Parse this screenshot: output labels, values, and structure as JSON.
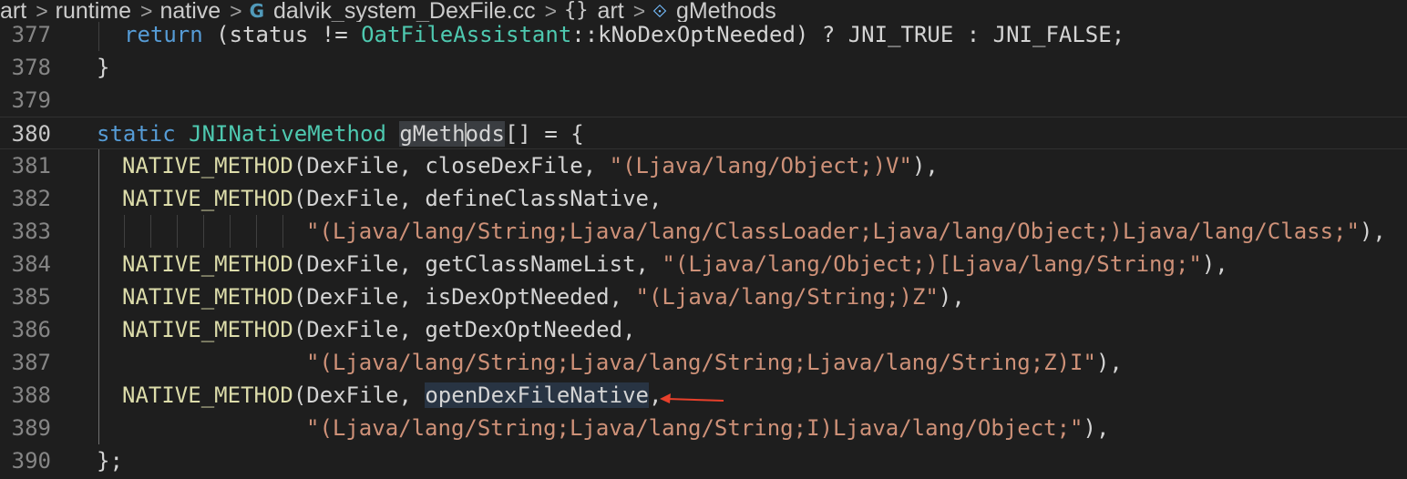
{
  "breadcrumb": {
    "items": [
      "art",
      "runtime",
      "native",
      "dalvik_system_DexFile.cc",
      "art",
      "gMethods"
    ],
    "separator": ">",
    "file_icon_glyph": "G",
    "namespace_icon_glyph": "{}",
    "variable_icon_glyph": "⟐",
    "icons": [
      "cpp-file-icon",
      "namespace-icon",
      "variable-icon"
    ]
  },
  "editor": {
    "current_line": "380",
    "line_numbers": [
      "377",
      "378",
      "379",
      "380",
      "381",
      "382",
      "383",
      "384",
      "385",
      "386",
      "387",
      "388",
      "389",
      "390"
    ],
    "code": {
      "l377": {
        "t1": "return",
        "t2": " (status != ",
        "t3": "OatFileAssistant",
        "t4": "::kNoDexOptNeeded) ? JNI_TRUE : JNI_FALSE;"
      },
      "l378": {
        "t1": "}"
      },
      "l380": {
        "t1": "static",
        "t2": " ",
        "t3": "JNINativeMethod",
        "t4": " ",
        "t5a": "gMeth",
        "t5b": "ods",
        "t6": "[] = {"
      },
      "l381": {
        "macro": "NATIVE_METHOD",
        "args": "(DexFile, closeDexFile, ",
        "str": "\"(Ljava/lang/Object;)V\"",
        "end": "),"
      },
      "l382": {
        "macro": "NATIVE_METHOD",
        "args": "(DexFile, defineClassNative,"
      },
      "l383": {
        "str": "\"(Ljava/lang/String;Ljava/lang/ClassLoader;Ljava/lang/Object;)Ljava/lang/Class;\"",
        "end": "),"
      },
      "l384": {
        "macro": "NATIVE_METHOD",
        "args": "(DexFile, getClassNameList, ",
        "str": "\"(Ljava/lang/Object;)[Ljava/lang/String;\"",
        "end": "),"
      },
      "l385": {
        "macro": "NATIVE_METHOD",
        "args": "(DexFile, isDexOptNeeded, ",
        "str": "\"(Ljava/lang/String;)Z\"",
        "end": "),"
      },
      "l386": {
        "macro": "NATIVE_METHOD",
        "args": "(DexFile, getDexOptNeeded,"
      },
      "l387": {
        "str": "\"(Ljava/lang/String;Ljava/lang/String;Ljava/lang/String;Z)I\"",
        "end": "),"
      },
      "l388": {
        "macro": "NATIVE_METHOD",
        "args": "(DexFile, ",
        "ident": "openDexFileNative",
        "end": ","
      },
      "l389": {
        "str": "\"(Ljava/lang/String;Ljava/lang/String;I)Ljava/lang/Object;\"",
        "end": "),"
      },
      "l390": {
        "t1": "};"
      }
    }
  },
  "colors": {
    "background": "#1e1e1e",
    "keyword": "#569cd6",
    "macro": "#dcdcaa",
    "type": "#4ec9b0",
    "string": "#ce9178",
    "text": "#d4d4d4",
    "line_number": "#858585",
    "annotation_arrow": "#e8402b"
  }
}
